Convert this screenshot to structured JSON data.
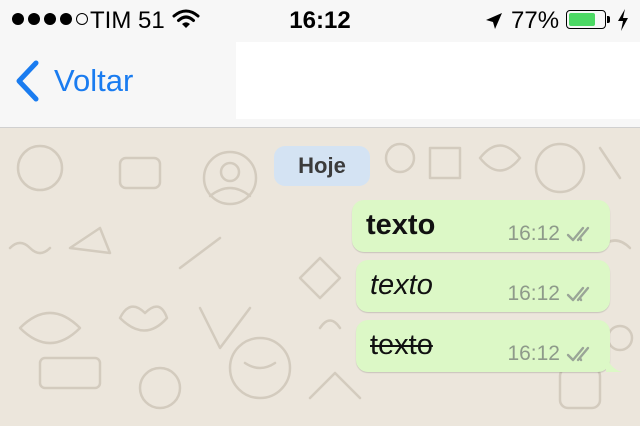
{
  "status_bar": {
    "carrier": "TIM 51",
    "time": "16:12",
    "battery_percent": "77%",
    "battery_level": 0.77,
    "signal_bars_filled": 4,
    "signal_bars_total": 5,
    "icons": [
      "wifi-icon",
      "location-arrow-icon",
      "battery-icon",
      "charging-bolt-icon"
    ]
  },
  "nav": {
    "back_label": "Voltar",
    "back_icon": "chevron-left-icon",
    "accent_color": "#1a7cf0"
  },
  "chat": {
    "date_label": "Hoje",
    "messages": [
      {
        "text": "texto",
        "style": "bold",
        "time": "16:12",
        "status": "read",
        "status_icon": "double-check-icon"
      },
      {
        "text": "texto",
        "style": "italic",
        "time": "16:12",
        "status": "read",
        "status_icon": "double-check-icon"
      },
      {
        "text": "texto",
        "style": "strikethrough",
        "time": "16:12",
        "status": "read",
        "status_icon": "double-check-icon"
      }
    ],
    "bubble_color": "#dcf8c6",
    "background_color": "#ece6dc"
  }
}
